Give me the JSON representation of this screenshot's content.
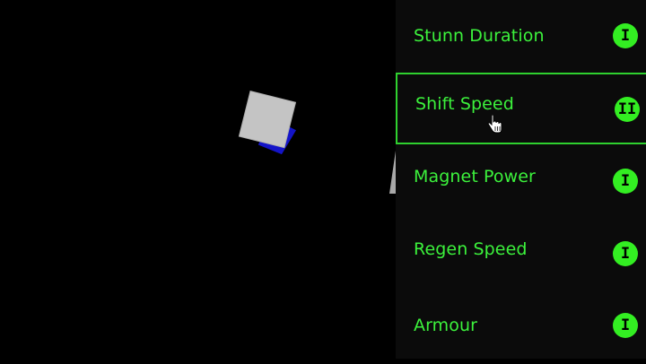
{
  "colors": {
    "accent": "#3cf23c",
    "panel_bg": "#0b0b0b",
    "game_bg": "#000000",
    "badge": "#33ee22"
  },
  "upgrades": [
    {
      "label": "Stunn Duration",
      "level": "I"
    },
    {
      "label": "Shift Speed",
      "level": "II",
      "selected": true
    },
    {
      "label": "Magnet Power",
      "level": "I"
    },
    {
      "label": "Regen Speed",
      "level": "I"
    },
    {
      "label": "Armour",
      "level": "I"
    }
  ],
  "cursor": "hand-pointer-icon"
}
